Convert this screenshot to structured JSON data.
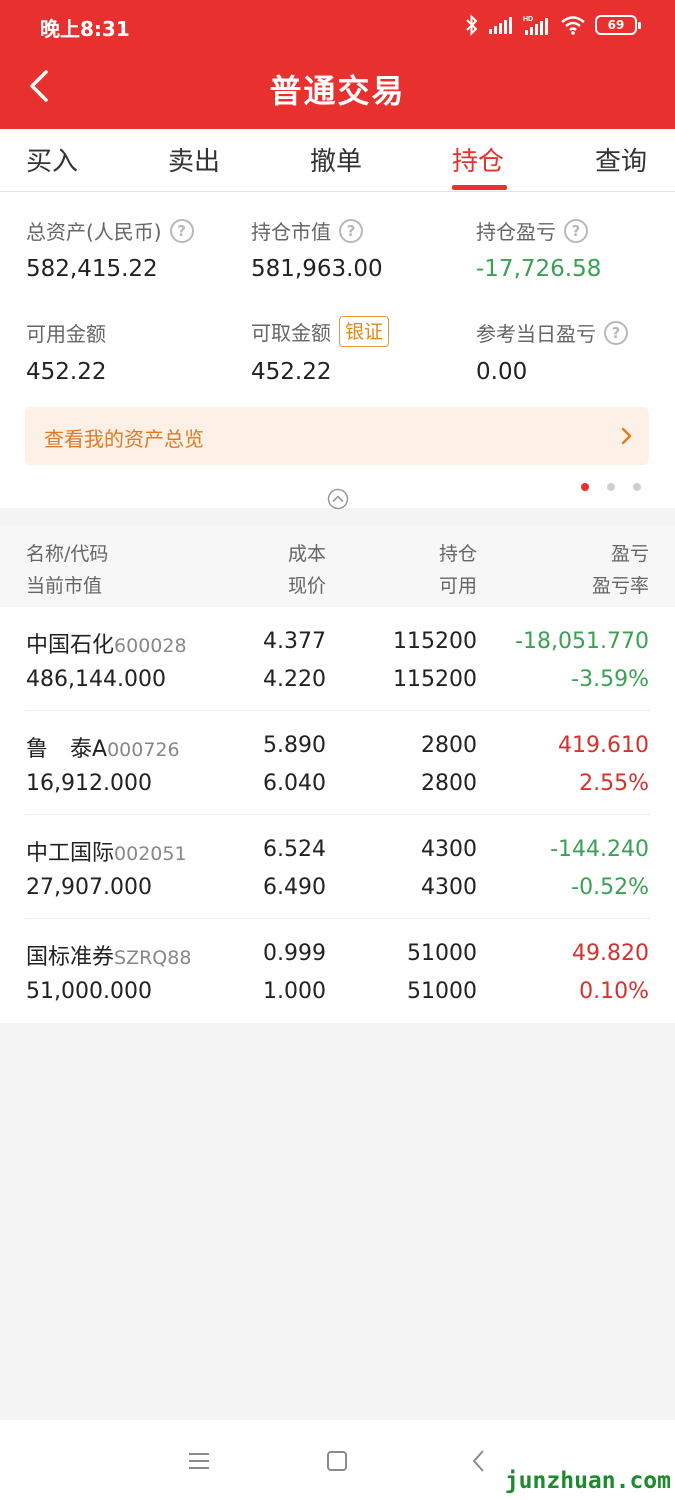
{
  "status": {
    "time": "晚上8:31",
    "battery": "69"
  },
  "header": {
    "title": "普通交易"
  },
  "tabs": [
    {
      "label": "买入"
    },
    {
      "label": "卖出"
    },
    {
      "label": "撤单"
    },
    {
      "label": "持仓",
      "active": true
    },
    {
      "label": "查询"
    }
  ],
  "summary": {
    "total_assets_label": "总资产(人民币)",
    "total_assets": "582,415.22",
    "market_value_label": "持仓市值",
    "market_value": "581,963.00",
    "pnl_label": "持仓盈亏",
    "pnl": "-17,726.58",
    "available_label": "可用金额",
    "available": "452.22",
    "withdrawable_label": "可取金额",
    "bank_transfer_label": "银证",
    "withdrawable": "452.22",
    "today_pnl_label": "参考当日盈亏",
    "today_pnl": "0.00",
    "overview_label": "查看我的资产总览"
  },
  "table": {
    "headers": {
      "name_code": "名称/代码",
      "market_value": "当前市值",
      "cost": "成本",
      "price": "现价",
      "holding": "持仓",
      "available": "可用",
      "pnl": "盈亏",
      "pnl_rate": "盈亏率"
    },
    "rows": [
      {
        "name": "中国石化",
        "code": "600028",
        "market_value": "486,144.000",
        "cost": "4.377",
        "price": "4.220",
        "holding": "115200",
        "available": "115200",
        "pnl": "-18,051.770",
        "pnl_rate": "-3.59%",
        "direction": "neg"
      },
      {
        "name": "鲁　泰A",
        "code": "000726",
        "market_value": "16,912.000",
        "cost": "5.890",
        "price": "6.040",
        "holding": "2800",
        "available": "2800",
        "pnl": "419.610",
        "pnl_rate": "2.55%",
        "direction": "pos"
      },
      {
        "name": "中工国际",
        "code": "002051",
        "market_value": "27,907.000",
        "cost": "6.524",
        "price": "6.490",
        "holding": "4300",
        "available": "4300",
        "pnl": "-144.240",
        "pnl_rate": "-0.52%",
        "direction": "neg"
      },
      {
        "name": "国标准券",
        "code": "SZRQ88",
        "market_value": "51,000.000",
        "cost": "0.999",
        "price": "1.000",
        "holding": "51000",
        "available": "51000",
        "pnl": "49.820",
        "pnl_rate": "0.10%",
        "direction": "pos"
      }
    ]
  },
  "colors": {
    "brand_red": "#e8312f",
    "gain_red": "#d6312c",
    "loss_green": "#3aa152",
    "accent_orange": "#e07a24"
  },
  "watermark": "junzhuan.com"
}
